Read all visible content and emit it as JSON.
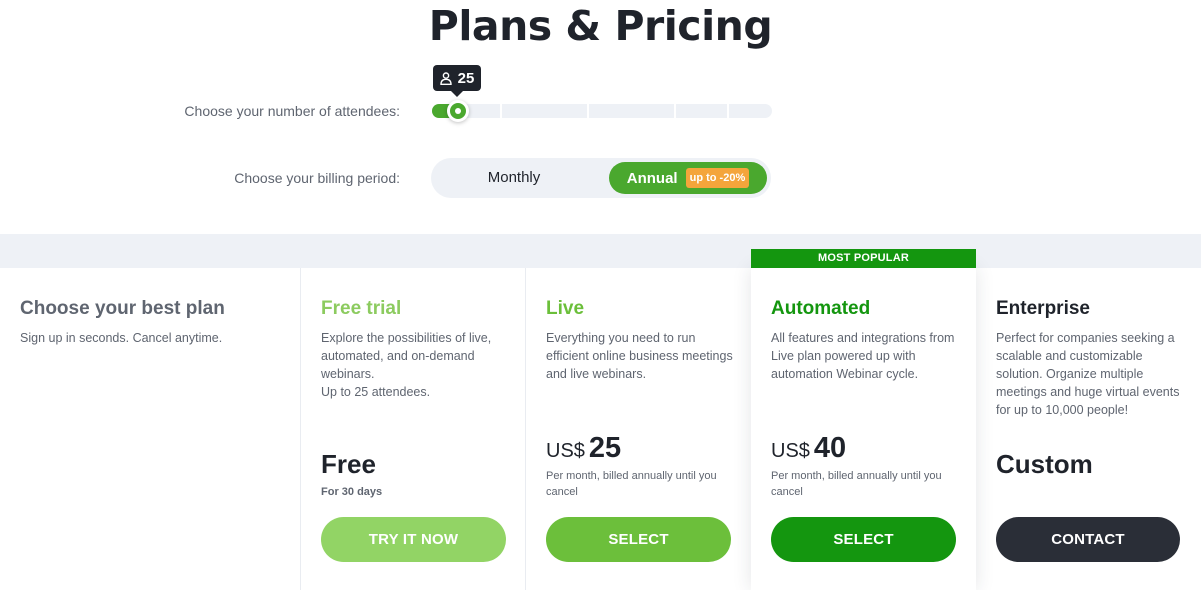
{
  "page": {
    "title": "Plans & Pricing"
  },
  "attendees": {
    "label": "Choose your number of attendees:",
    "value": "25",
    "level_fraction": 0.07
  },
  "billing": {
    "label": "Choose your billing period:",
    "monthly": "Monthly",
    "annual": "Annual",
    "annual_badge": "up to -20%",
    "selected": "Annual"
  },
  "intro": {
    "title": "Choose your best plan",
    "subtitle": "Sign up in seconds. Cancel anytime."
  },
  "popular_label": "MOST POPULAR",
  "plans": [
    {
      "name": "Free trial",
      "name_color": "#8ccb5f",
      "description": "Explore the possibilities of live, automated, and on-demand webinars.\nUp to 25 attendees.",
      "price": "Free",
      "note": "For 30 days",
      "button": "TRY IT NOW",
      "button_color": "#92d465"
    },
    {
      "name": "Live",
      "name_color": "#6bbf3a",
      "description": "Everything you need to run efficient online business meetings and live webinars.",
      "currency": "US$",
      "price": "25",
      "note": "Per month, billed annually until you cancel",
      "button": "SELECT",
      "button_color": "#6cbf3b"
    },
    {
      "name": "Automated",
      "name_color": "#14960f",
      "description": "All features and integrations from Live plan powered up with automation Webinar cycle.",
      "currency": "US$",
      "price": "40",
      "note": "Per month, billed annually until you cancel",
      "button": "SELECT",
      "button_color": "#14960f"
    },
    {
      "name": "Enterprise",
      "name_color": "#1f232b",
      "description": "Perfect for companies seeking a scalable and customizable solution. Organize multiple meetings and huge virtual events for up to 10,000 people!",
      "price": "Custom",
      "button": "CONTACT",
      "button_color": "#2a2e37"
    }
  ],
  "icons": {
    "tooltip": "user-icon"
  }
}
